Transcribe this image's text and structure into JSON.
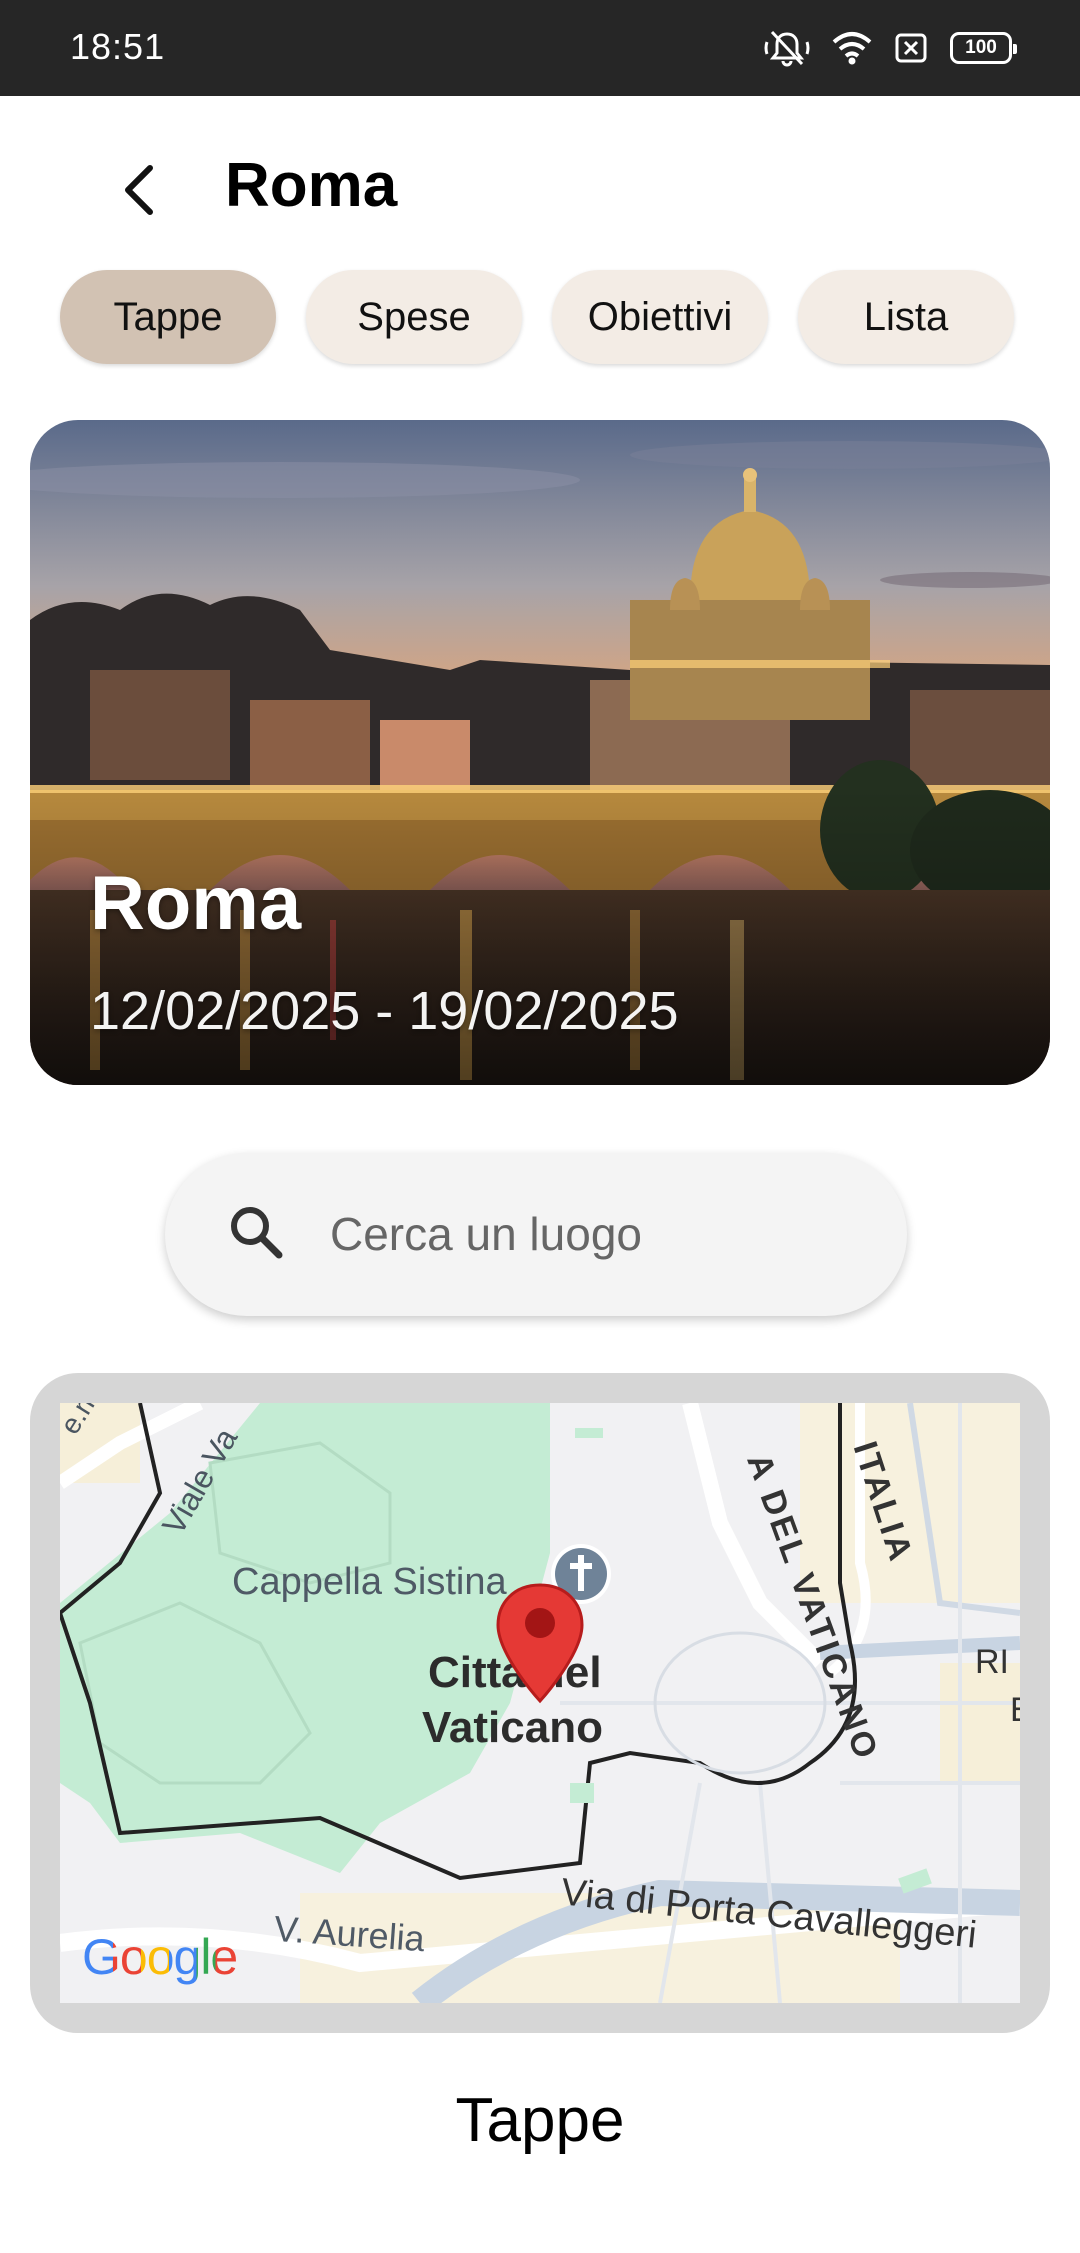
{
  "status_bar": {
    "time": "18:51",
    "battery": "100",
    "icons": [
      "silent-bell-icon",
      "wifi-icon",
      "sim-off-icon",
      "battery-icon"
    ]
  },
  "header": {
    "title": "Roma",
    "back_icon": "back-arrow-icon"
  },
  "tabs": [
    {
      "label": "Tappe",
      "active": true
    },
    {
      "label": "Spese",
      "active": false
    },
    {
      "label": "Obiettivi",
      "active": false
    },
    {
      "label": "Lista",
      "active": false
    }
  ],
  "hero": {
    "title": "Roma",
    "dates": "12/02/2025 - 19/02/2025"
  },
  "search": {
    "placeholder": "Cerca un luogo",
    "icon": "search-icon"
  },
  "map": {
    "labels": {
      "cappella": "Cappella Sistina",
      "city_line1": "Città del",
      "city_line2": "Vaticano",
      "via_porta": "Via di Porta Cavalleggeri",
      "aurelia": "V. Aurelia",
      "viale": "Viale Va",
      "del_vaticano": "A DEL VATICANO",
      "italia": "ITALIA",
      "ri": "RI",
      "e": "E",
      "mo": "e.mo"
    },
    "logo": "Google",
    "marker_icon": "map-pin-icon",
    "church_icon": "church-cross-icon"
  },
  "section": {
    "title": "Tappe"
  },
  "colors": {
    "tab_active": "#d2c2b3",
    "tab_inactive": "#f3ece5",
    "status_bar": "#262626",
    "park_green": "#c4ecd4",
    "marker_red": "#e53935"
  }
}
